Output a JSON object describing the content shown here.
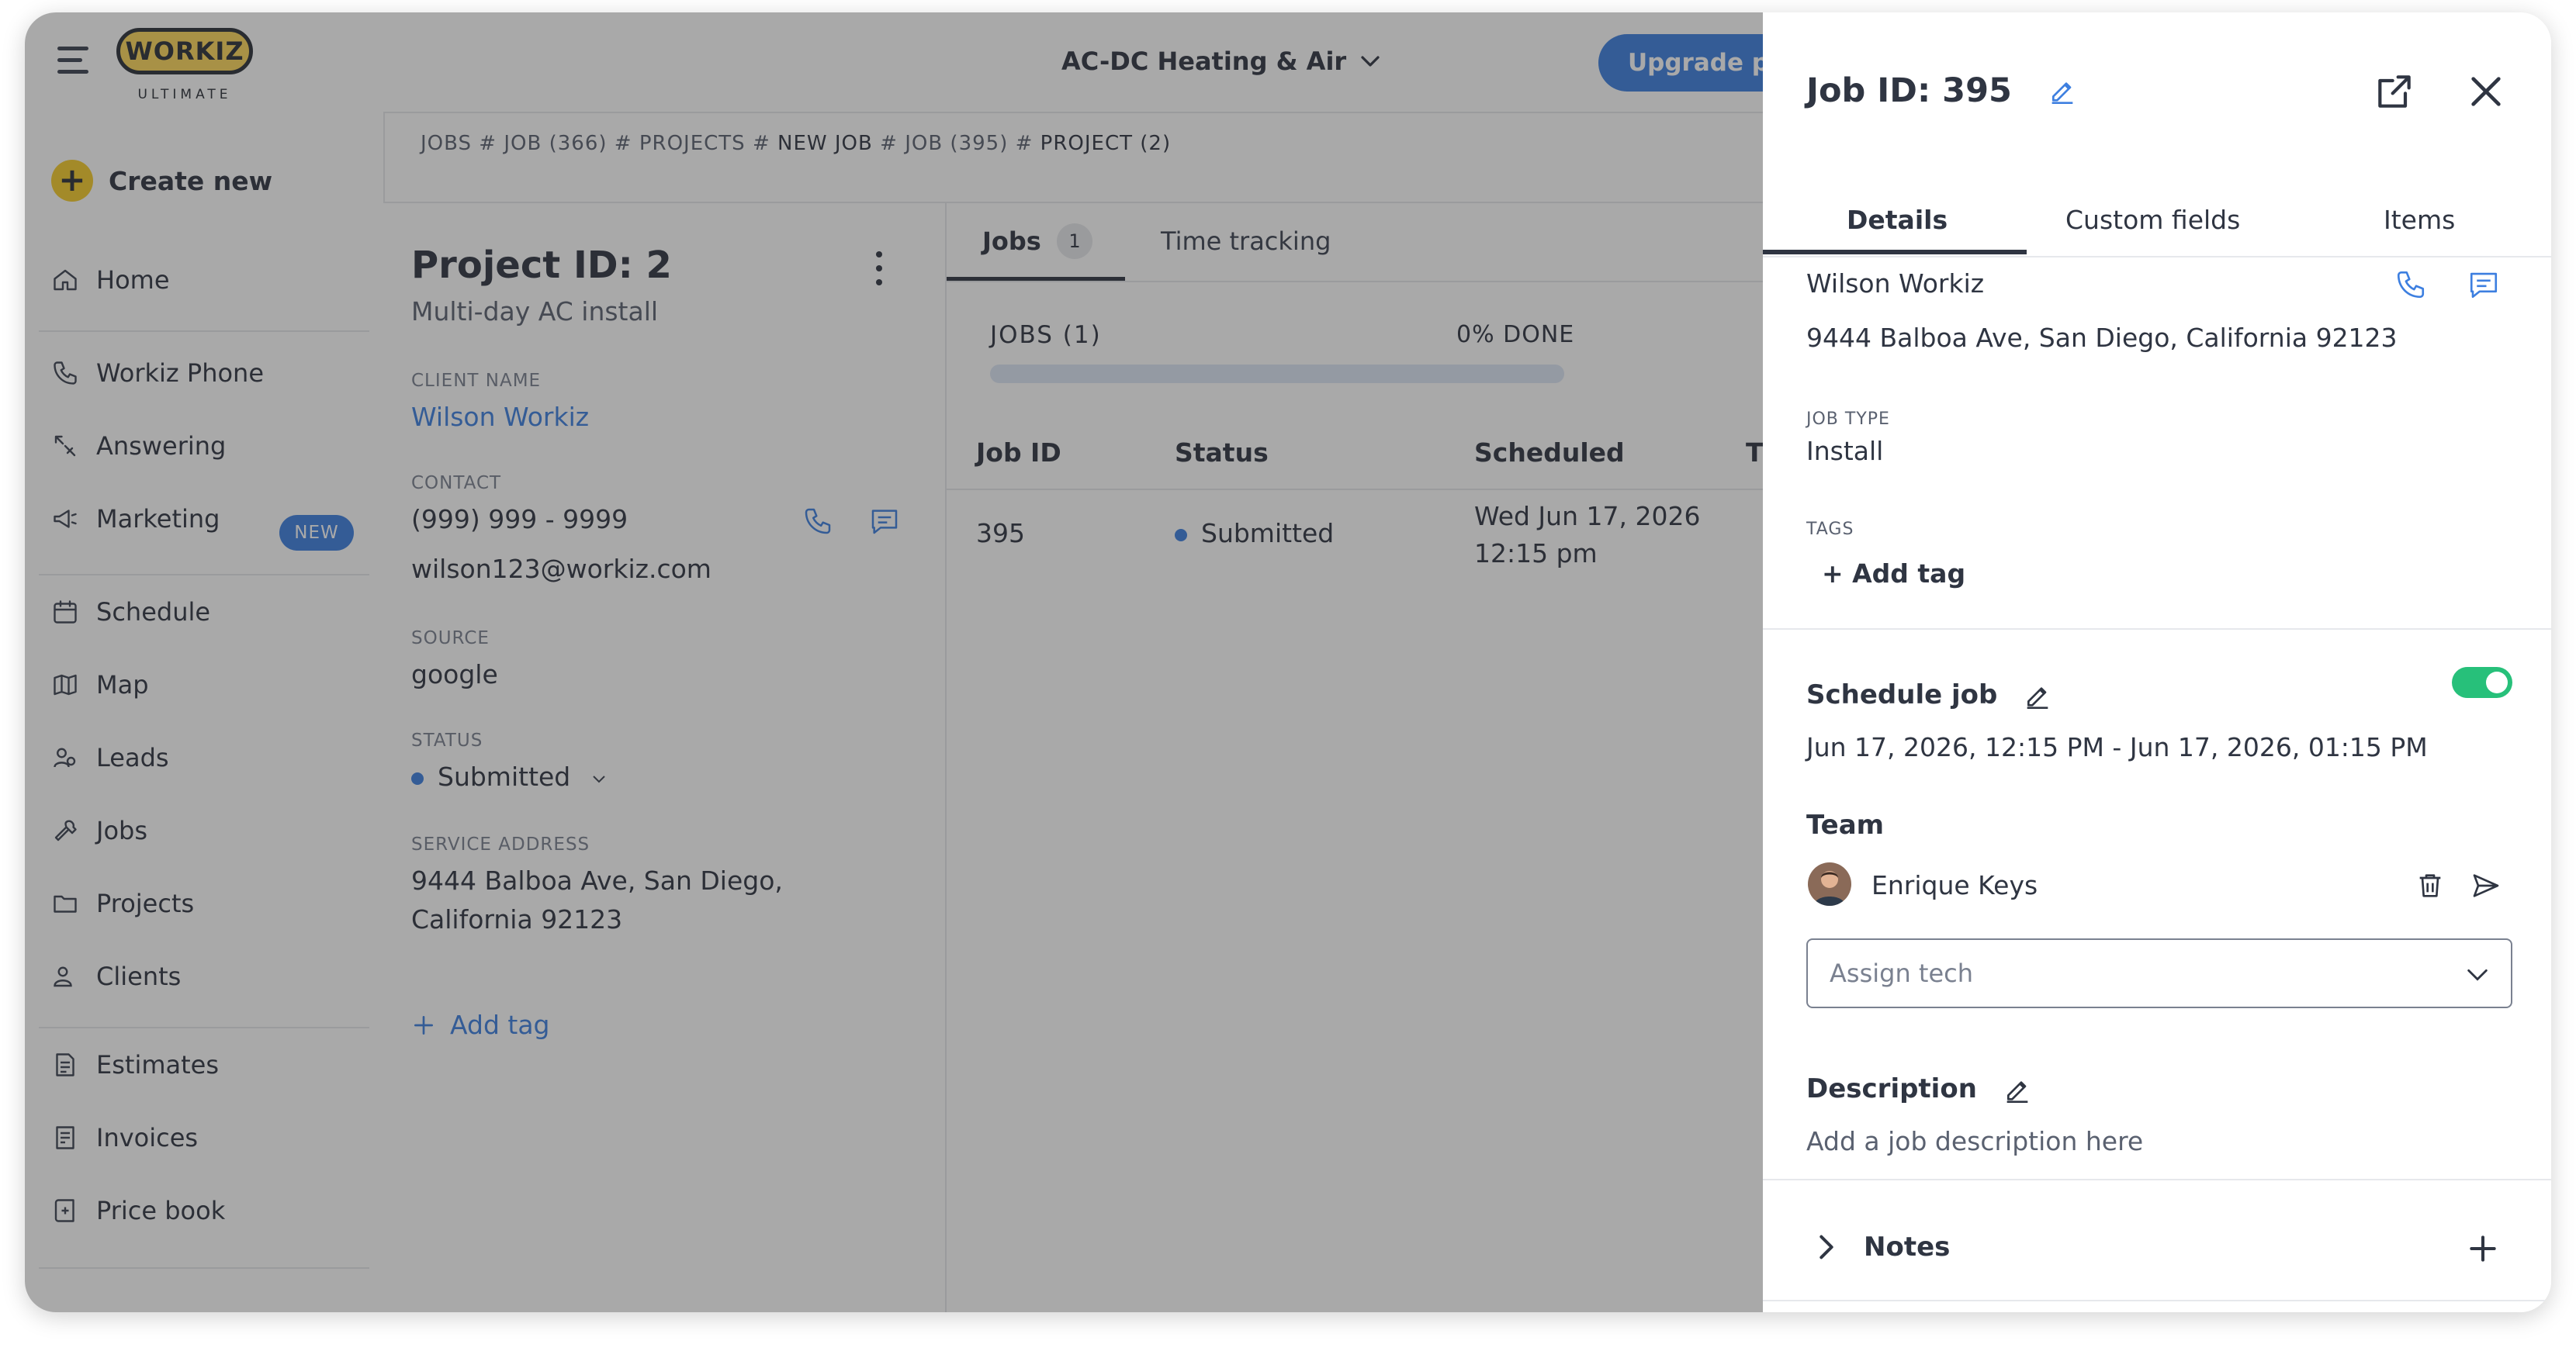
{
  "topbar": {
    "logo_text": "WORKIZ",
    "logo_sub": "ULTIMATE",
    "company": "AC-DC Heating & Air",
    "upgrade": "Upgrade pl"
  },
  "sidebar": {
    "create_new": "Create new",
    "items": [
      {
        "label": "Home",
        "icon": "home-icon"
      },
      {
        "label": "Workiz Phone",
        "icon": "phone-icon"
      },
      {
        "label": "Answering",
        "icon": "answering-icon"
      },
      {
        "label": "Marketing",
        "icon": "megaphone-icon",
        "badge": "NEW"
      },
      {
        "label": "Schedule",
        "icon": "calendar-icon"
      },
      {
        "label": "Map",
        "icon": "map-icon"
      },
      {
        "label": "Leads",
        "icon": "leads-icon"
      },
      {
        "label": "Jobs",
        "icon": "wrench-icon"
      },
      {
        "label": "Projects",
        "icon": "folder-icon"
      },
      {
        "label": "Clients",
        "icon": "users-icon"
      },
      {
        "label": "Estimates",
        "icon": "estimate-icon"
      },
      {
        "label": "Invoices",
        "icon": "invoice-icon"
      },
      {
        "label": "Price book",
        "icon": "book-icon"
      }
    ]
  },
  "breadcrumb": {
    "parts": [
      "JOBS",
      "JOB (366)",
      "PROJECTS",
      "NEW JOB",
      "JOB (395)",
      "PROJECT (2)"
    ],
    "separator": "#"
  },
  "project": {
    "title": "Project ID: 2",
    "subtitle": "Multi-day AC install",
    "client_label": "CLIENT NAME",
    "client_name": "Wilson Workiz",
    "contact_label": "CONTACT",
    "phone": "(999) 999 - 9999",
    "email": "wilson123@workiz.com",
    "source_label": "SOURCE",
    "source": "google",
    "status_label": "STATUS",
    "status": "Submitted",
    "address_label": "SERVICE ADDRESS",
    "address_line1": "9444 Balboa Ave, San Diego,",
    "address_line2": "California 92123",
    "add_tag": "Add tag"
  },
  "jobs_panel": {
    "tab_jobs": "Jobs",
    "tab_jobs_count": "1",
    "tab_time": "Time tracking",
    "jobs_count_label": "JOBS (1)",
    "done_label": "0% DONE",
    "progress": 0,
    "headers": [
      "Job ID",
      "Status",
      "Scheduled",
      "T"
    ],
    "row": {
      "job_id": "395",
      "status": "Submitted",
      "scheduled_line1": "Wed Jun 17, 2026",
      "scheduled_line2": "12:15 pm"
    }
  },
  "drawer": {
    "title": "Job ID: 395",
    "tabs": [
      "Details",
      "Custom fields",
      "Items"
    ],
    "client_name": "Wilson Workiz",
    "address": "9444 Balboa Ave, San Diego, California 92123",
    "job_type_label": "JOB TYPE",
    "job_type": "Install",
    "tags_label": "TAGS",
    "add_tag": "+ Add tag",
    "schedule_label": "Schedule job",
    "schedule_enabled": true,
    "schedule_range": "Jun 17, 2026, 12:15 PM - Jun 17, 2026, 01:15 PM",
    "team_label": "Team",
    "team_member": "Enrique Keys",
    "assign_placeholder": "Assign tech",
    "description_label": "Description",
    "description_placeholder": "Add a job description here",
    "notes_label": "Notes"
  },
  "colors": {
    "accent": "#3d7fe0",
    "logo_yellow": "#fdd85a",
    "toggle_on": "#27c07a"
  }
}
